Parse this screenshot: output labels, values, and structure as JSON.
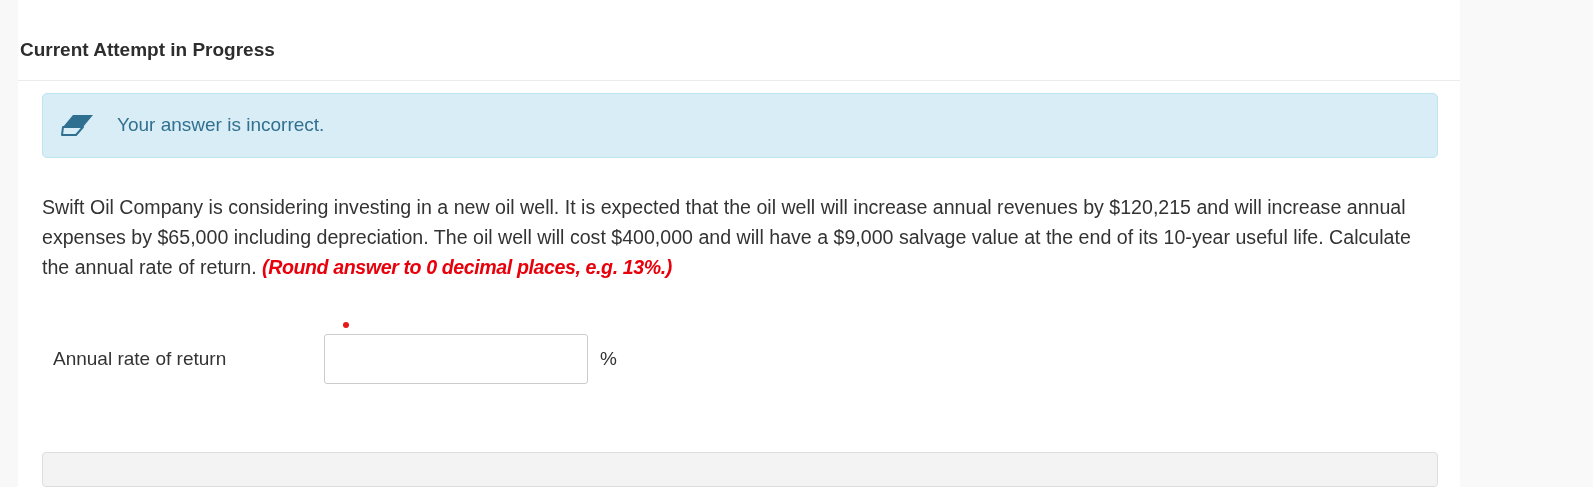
{
  "heading": "Current Attempt in Progress",
  "alert": {
    "kind": "incorrect",
    "text": "Your answer is incorrect."
  },
  "question": {
    "text": "Swift Oil Company is considering investing in a new oil well. It is expected that the oil well will increase annual revenues by $120,215 and will increase annual expenses by $65,000 including depreciation. The oil well will cost $400,000 and will have a $9,000 salvage value at the end of its 10-year useful life. Calculate the annual rate of return.",
    "instruction": "(Round answer to 0 decimal places, e.g. 13%.)"
  },
  "answer": {
    "label": "Annual rate of return",
    "required": true,
    "unit": "%"
  }
}
